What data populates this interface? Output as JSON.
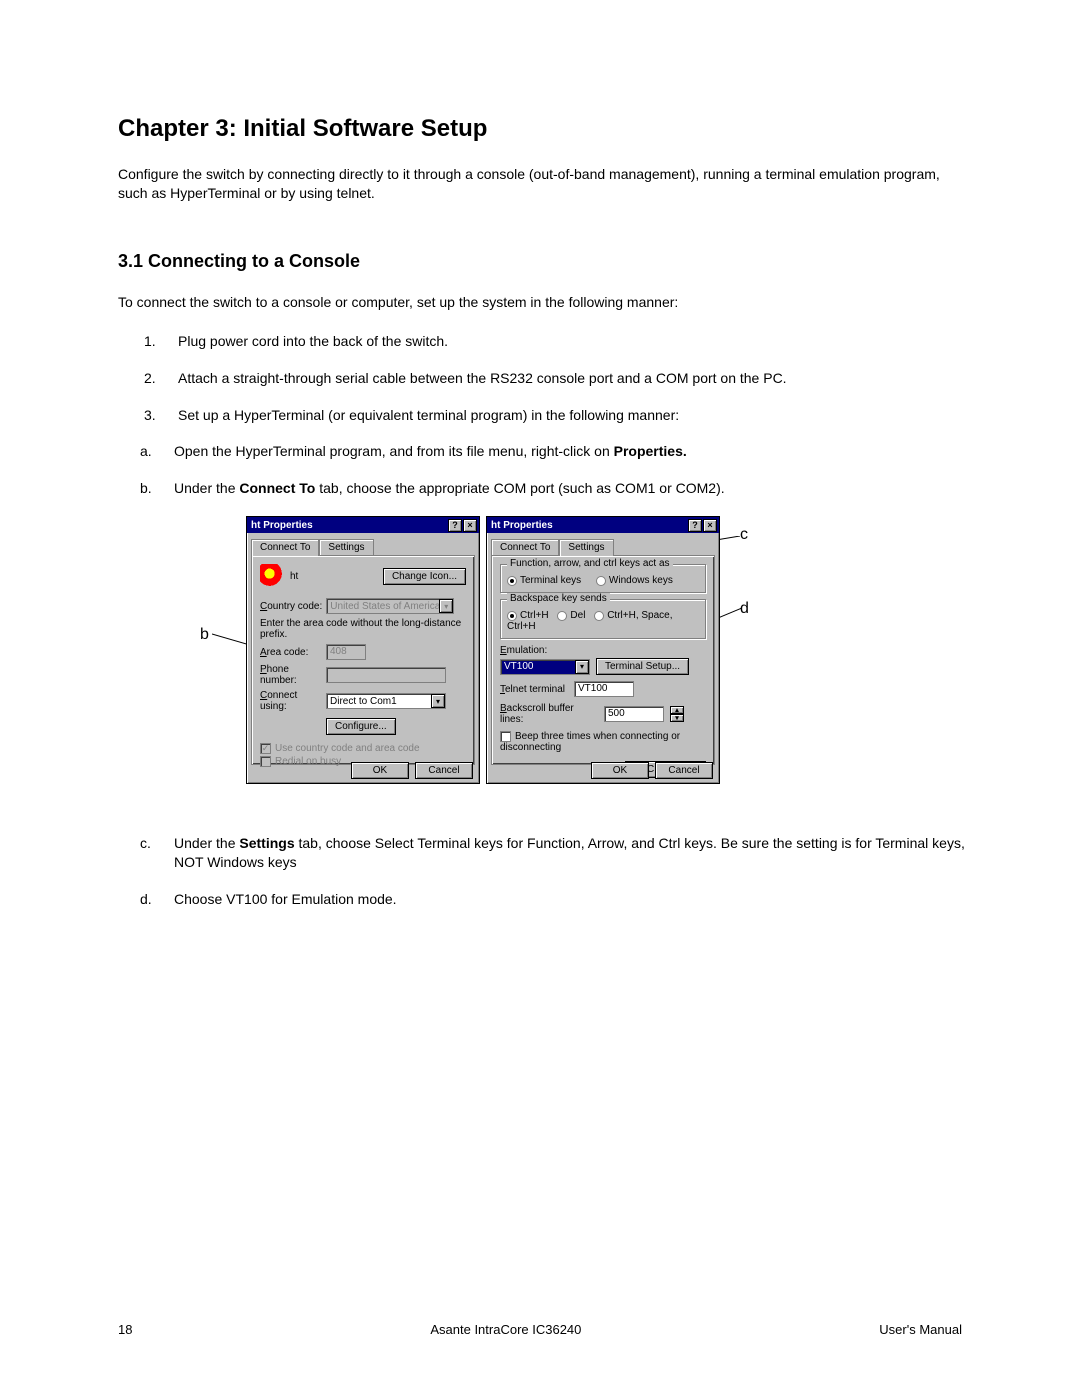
{
  "doc": {
    "chapter_title": "Chapter 3: Initial Software Setup",
    "intro": "Configure the switch by connecting directly to it through a console (out-of-band management), running a terminal emulation program, such as HyperTerminal or by using telnet.",
    "section_title": "3.1 Connecting to a Console",
    "lead": "To connect the switch to a console or computer, set up the system in the following manner:",
    "steps": {
      "n1": "1.",
      "s1": "Plug power cord into the back of the switch.",
      "n2": "2.",
      "s2": "Attach a straight-through serial cable between the RS232 console port and a COM port on the PC.",
      "n3": "3.",
      "s3": "Set up a HyperTerminal (or equivalent terminal program) in the following manner:"
    },
    "sub": {
      "na": "a.",
      "a_pre": "Open the HyperTerminal program, and from its file menu, right-click on ",
      "a_bold": "Properties.",
      "nb": "b.",
      "b_pre": "Under the ",
      "b_bold": "Connect To",
      "b_post": " tab, choose the appropriate COM port (such as COM1 or COM2).",
      "nc": "c.",
      "c_pre": "Under the ",
      "c_bold": "Settings",
      "c_post": " tab, choose Select Terminal keys for Function, Arrow, and Ctrl keys. Be sure the setting is for Terminal keys, NOT Windows keys",
      "nd": "d.",
      "d": "Choose VT100 for Emulation mode."
    },
    "callouts": {
      "b": "b",
      "c": "c",
      "d": "d"
    }
  },
  "dlg_left": {
    "title": "ht Properties",
    "tabs": {
      "t1": "Connect To",
      "t2": "Settings"
    },
    "conn_name": "ht",
    "change_icon": "Change Icon...",
    "country_label": "Country code:",
    "country_value": "United States of America (1)",
    "area_hint": "Enter the area code without the long-distance prefix.",
    "area_label": "Area code:",
    "area_value": "408",
    "phone_label": "Phone number:",
    "phone_value": "",
    "connect_label": "Connect using:",
    "connect_value": "Direct to Com1",
    "configure": "Configure...",
    "chk1": "Use country code and area code",
    "chk2": "Redial on busy",
    "ok": "OK",
    "cancel": "Cancel"
  },
  "dlg_right": {
    "title": "ht Properties",
    "tabs": {
      "t1": "Connect To",
      "t2": "Settings"
    },
    "group1": "Function, arrow, and ctrl keys act as",
    "r_term": "Terminal keys",
    "r_win": "Windows keys",
    "group2": "Backspace key sends",
    "r_ctrlh": "Ctrl+H",
    "r_del": "Del",
    "r_ctrlh2": "Ctrl+H, Space, Ctrl+H",
    "emu_label": "Emulation:",
    "emu_value": "VT100",
    "term_setup": "Terminal Setup...",
    "telnet_label": "Telnet terminal",
    "telnet_value": "VT100",
    "backscroll_label": "Backscroll buffer lines:",
    "backscroll_value": "500",
    "beep": "Beep three times when connecting or disconnecting",
    "ascii_setup": "ASCII Setup...",
    "ok": "OK",
    "cancel": "Cancel"
  },
  "footer": {
    "page": "18",
    "center": "Asante IntraCore IC36240",
    "right": "User's Manual"
  }
}
